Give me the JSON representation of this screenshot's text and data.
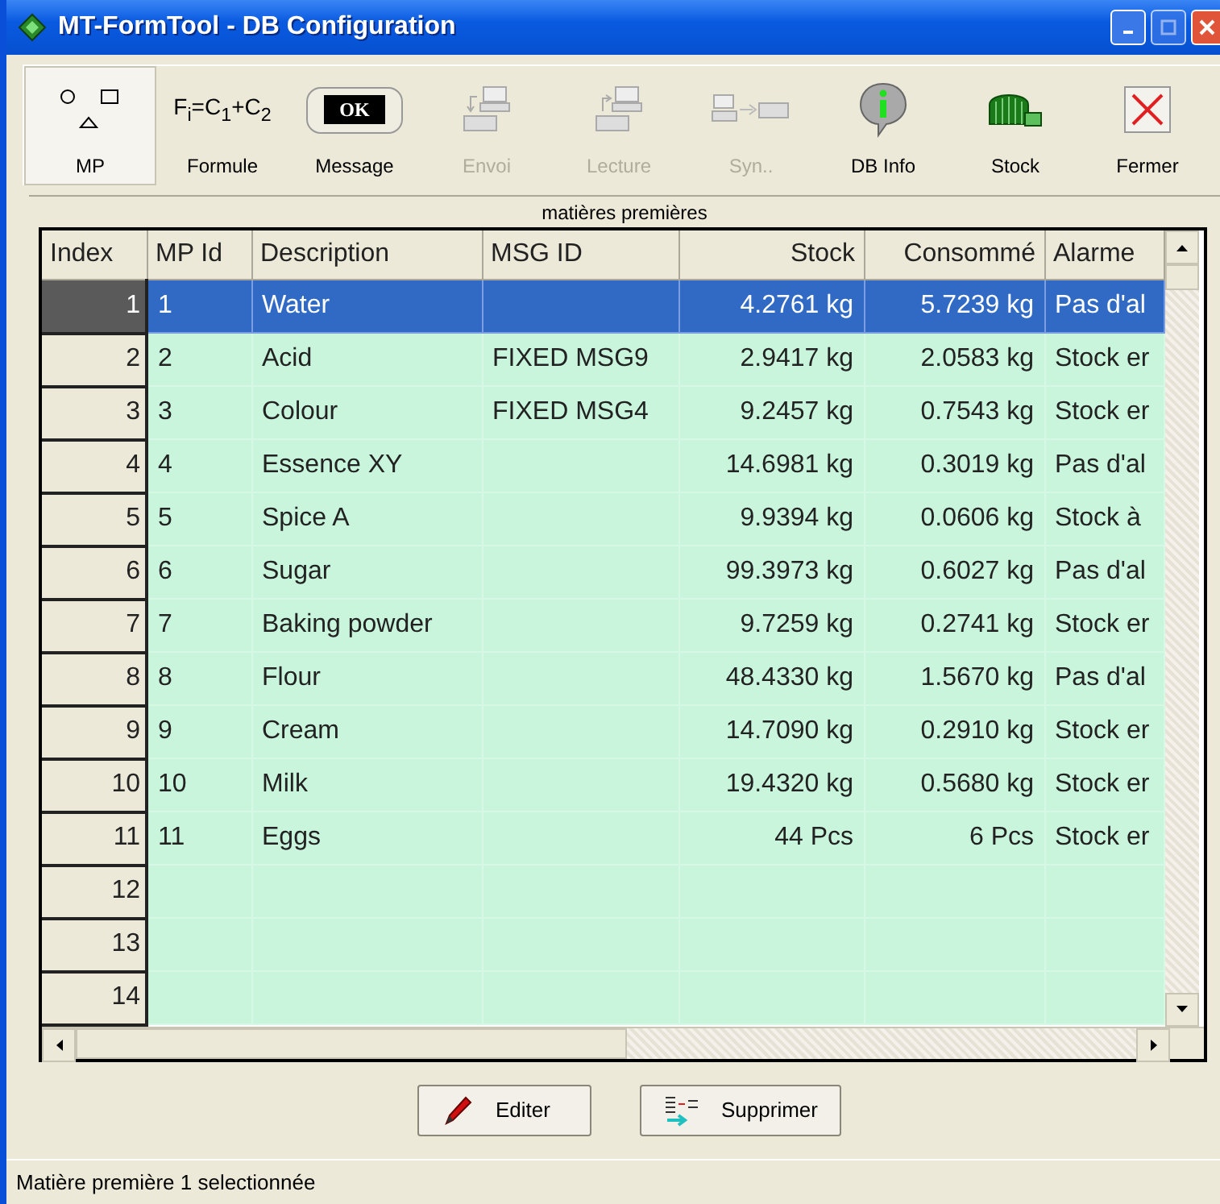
{
  "window": {
    "title": "MT-FormTool - DB Configuration"
  },
  "toolbar": [
    {
      "label": "MP",
      "kind": "shapes",
      "selected": true,
      "disabled": false
    },
    {
      "label": "Formule",
      "kind": "formula",
      "formula": "F$_{i}$=C$_{1}$+C$_{2}$",
      "selected": false,
      "disabled": false
    },
    {
      "label": "Message",
      "kind": "ok",
      "badge": "OK",
      "selected": false,
      "disabled": false
    },
    {
      "label": "Envoi",
      "kind": "send",
      "selected": false,
      "disabled": true
    },
    {
      "label": "Lecture",
      "kind": "read",
      "selected": false,
      "disabled": true
    },
    {
      "label": "Syn..",
      "kind": "sync",
      "selected": false,
      "disabled": true
    },
    {
      "label": "DB Info",
      "kind": "info",
      "selected": false,
      "disabled": false
    },
    {
      "label": "Stock",
      "kind": "stock",
      "selected": false,
      "disabled": false
    },
    {
      "label": "Fermer",
      "kind": "close",
      "selected": false,
      "disabled": false
    }
  ],
  "table": {
    "caption": "matières premières",
    "columns": [
      "Index",
      "MP Id",
      "Description",
      "MSG ID",
      "Stock",
      "Consommé",
      "Alarme"
    ],
    "rows": [
      {
        "cells": [
          "1",
          "1",
          "Water",
          "",
          "4.2761 kg",
          "5.7239 kg",
          "Pas d'al"
        ],
        "selected": true
      },
      {
        "cells": [
          "2",
          "2",
          "Acid",
          "FIXED MSG9",
          "2.9417 kg",
          "2.0583 kg",
          "Stock er"
        ],
        "selected": false
      },
      {
        "cells": [
          "3",
          "3",
          "Colour",
          "FIXED MSG4",
          "9.2457 kg",
          "0.7543 kg",
          "Stock er"
        ],
        "selected": false
      },
      {
        "cells": [
          "4",
          "4",
          "Essence XY",
          "",
          "14.6981 kg",
          "0.3019 kg",
          "Pas d'al"
        ],
        "selected": false
      },
      {
        "cells": [
          "5",
          "5",
          "Spice A",
          "",
          "9.9394 kg",
          "0.0606 kg",
          "Stock à"
        ],
        "selected": false
      },
      {
        "cells": [
          "6",
          "6",
          "Sugar",
          "",
          "99.3973 kg",
          "0.6027 kg",
          "Pas d'al"
        ],
        "selected": false
      },
      {
        "cells": [
          "7",
          "7",
          "Baking powder",
          "",
          "9.7259 kg",
          "0.2741 kg",
          "Stock er"
        ],
        "selected": false
      },
      {
        "cells": [
          "8",
          "8",
          "Flour",
          "",
          "48.4330 kg",
          "1.5670 kg",
          "Pas d'al"
        ],
        "selected": false
      },
      {
        "cells": [
          "9",
          "9",
          "Cream",
          "",
          "14.7090 kg",
          "0.2910 kg",
          "Stock er"
        ],
        "selected": false
      },
      {
        "cells": [
          "10",
          "10",
          "Milk",
          "",
          "19.4320 kg",
          "0.5680 kg",
          "Stock er"
        ],
        "selected": false
      },
      {
        "cells": [
          "11",
          "11",
          "Eggs",
          "",
          "44 Pcs",
          "6 Pcs",
          "Stock er"
        ],
        "selected": false
      },
      {
        "cells": [
          "12"
        ],
        "selected": false
      },
      {
        "cells": [
          "13"
        ],
        "selected": false
      },
      {
        "cells": [
          "14"
        ],
        "selected": false
      }
    ]
  },
  "buttons": [
    {
      "label": "Editer",
      "kind": "edit"
    },
    {
      "label": "Supprimer",
      "kind": "delete"
    }
  ],
  "status_bar": "Matière première 1 selectionnée"
}
